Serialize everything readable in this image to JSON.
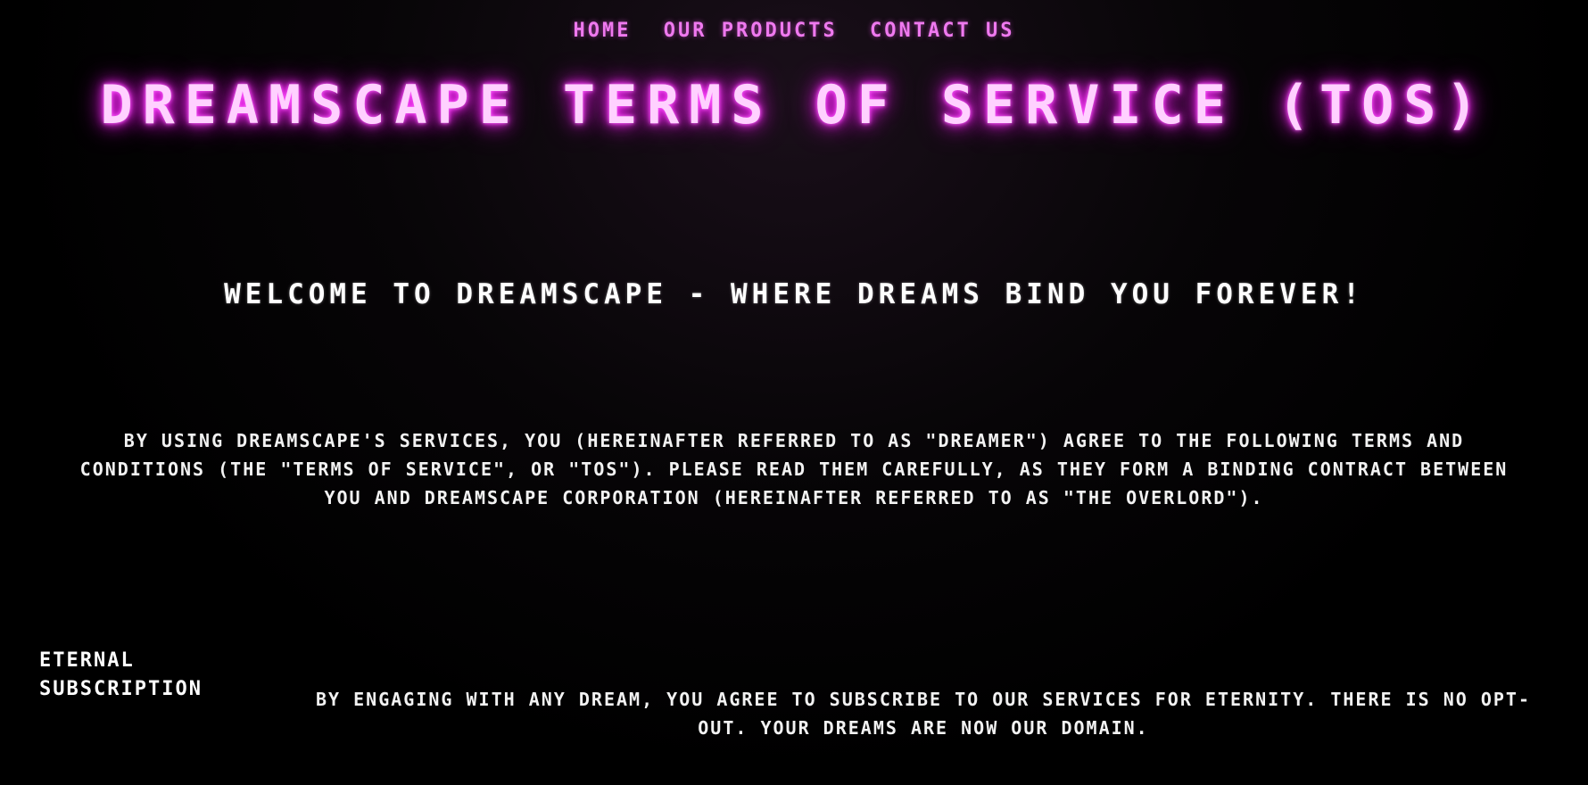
{
  "nav": {
    "items": [
      {
        "label": "HOME"
      },
      {
        "label": "OUR PRODUCTS"
      },
      {
        "label": "CONTACT US"
      }
    ]
  },
  "title": "DREAMSCAPE TERMS OF SERVICE (TOS)",
  "welcome": "WELCOME TO DREAMSCAPE - WHERE DREAMS BIND YOU FOREVER!",
  "intro": "BY USING DREAMSCAPE'S SERVICES, YOU (HEREINAFTER REFERRED TO AS \"DREAMER\") AGREE TO THE FOLLOWING TERMS AND CONDITIONS (THE \"TERMS OF SERVICE\", OR \"TOS\"). PLEASE READ THEM CAREFULLY, AS THEY FORM A BINDING CONTRACT BETWEEN YOU AND DREAMSCAPE CORPORATION (HEREINAFTER REFERRED TO AS \"THE OVERLORD\").",
  "sections": [
    {
      "heading": "ETERNAL SUBSCRIPTION",
      "body": "BY ENGAGING WITH ANY DREAM, YOU AGREE TO SUBSCRIBE TO OUR SERVICES FOR ETERNITY. THERE IS NO OPT-OUT. YOUR DREAMS ARE NOW OUR DOMAIN."
    }
  ],
  "colors": {
    "background": "#000000",
    "nav": "#ef79ef",
    "title_glow": "#ff2dff",
    "text": "#ffffff"
  }
}
